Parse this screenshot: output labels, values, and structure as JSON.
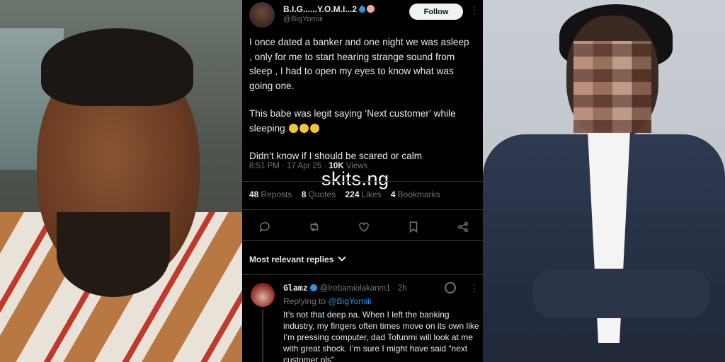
{
  "tweet": {
    "author_name": "B.I.G......Y.O.M.I...2",
    "author_handle": "@BigYomiii",
    "follow_label": "Follow",
    "body": [
      "I once dated a banker and one night we was asleep , only for me to start hearing strange sound from sleep , I had to open my eyes to know what was going one.",
      "This babe was legit saying ‘Next customer’ while sleeping",
      "Didn’t know if I should be scared or calm"
    ],
    "meta_time": "8:51 PM · 17 Apr 25 · ",
    "meta_views_count": "10K",
    "meta_views_label": " Views",
    "stats": {
      "reposts_count": "48",
      "reposts_label": "Reposts",
      "quotes_count": "8",
      "quotes_label": "Quotes",
      "likes_count": "224",
      "likes_label": "Likes",
      "bookmarks_count": "4",
      "bookmarks_label": "Bookmarks"
    }
  },
  "watermark": "skits.ng",
  "replies": {
    "header": "Most relevant replies",
    "reply": {
      "name": "Glamz",
      "handle": "@Irebamiolakanm1",
      "time": " · 2h",
      "replying_prefix": "Replying to ",
      "replying_to": "@BigYomiii",
      "text": "It’s not that deep na. When I left the banking industry, my fingers often times move on its own like I’m pressing computer, dad Tofunmi will look at me with great shock. I’m sure I might have said “next customer pls”"
    }
  },
  "icons": [
    "drop-icon",
    "peach-icon",
    "reply-icon",
    "repost-icon",
    "like-icon",
    "bookmark-icon",
    "share-icon",
    "verified-icon",
    "grok-icon",
    "more-icon"
  ]
}
